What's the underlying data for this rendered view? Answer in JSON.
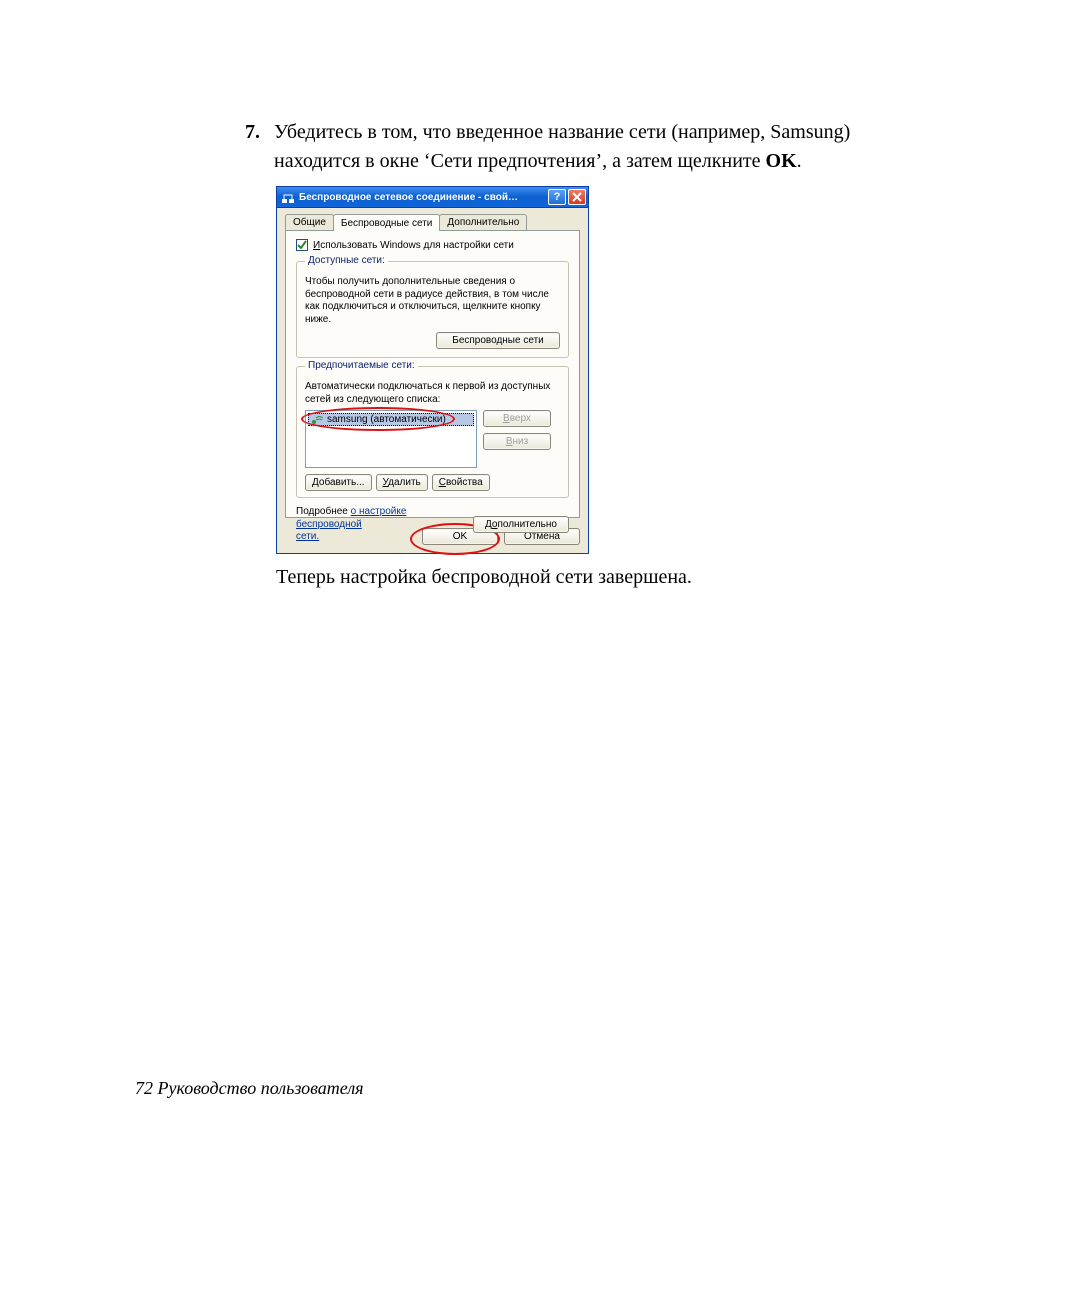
{
  "step_number": "7.",
  "instruction_text": "Убедитесь в том, что введенное название сети (например, Samsung) находится в окне ‘Сети предпочтения’, а затем щелкните ",
  "ok_text": "OK",
  "period": ".",
  "followup_text": "Теперь настройка беспроводной сети завершена.",
  "footer": "72  Руководство пользователя",
  "dialog": {
    "title": "Беспроводное сетевое соединение - свой…",
    "tabs": {
      "general": "Общие",
      "wireless": "Беспроводные сети",
      "advanced": "Дополнительно"
    },
    "use_windows_prefix": "И",
    "use_windows_rest": "спользовать Windows для настройки сети",
    "available": {
      "legend": "Доступные сети:",
      "desc": "Чтобы получить дополнительные сведения о беспроводной сети в радиусе действия, в том числе как подключиться и отключиться, щелкните кнопку ниже.",
      "button": "Беспроводные сети"
    },
    "preferred": {
      "legend": "Предпочитаемые сети:",
      "desc": "Автоматически подключаться к первой из доступных сетей из следующего списка:",
      "item": "samsung (автоматически)",
      "up_prefix": "В",
      "up_rest": "верх",
      "down_prefix": "В",
      "down_rest": "низ",
      "add_prefix": "Д",
      "add_rest": "обавить...",
      "del_prefix": "У",
      "del_rest": "далить",
      "prop_prefix": "С",
      "prop_rest": "войства"
    },
    "link": {
      "plain": "Подробнее ",
      "linked1": "о настройке беспроводной",
      "linked2": "сети.",
      "adv_prefix": "Д",
      "adv_middle": "о",
      "adv_rest": "полнительно"
    },
    "ok_btn": "OK",
    "cancel_btn": "Отмена"
  }
}
